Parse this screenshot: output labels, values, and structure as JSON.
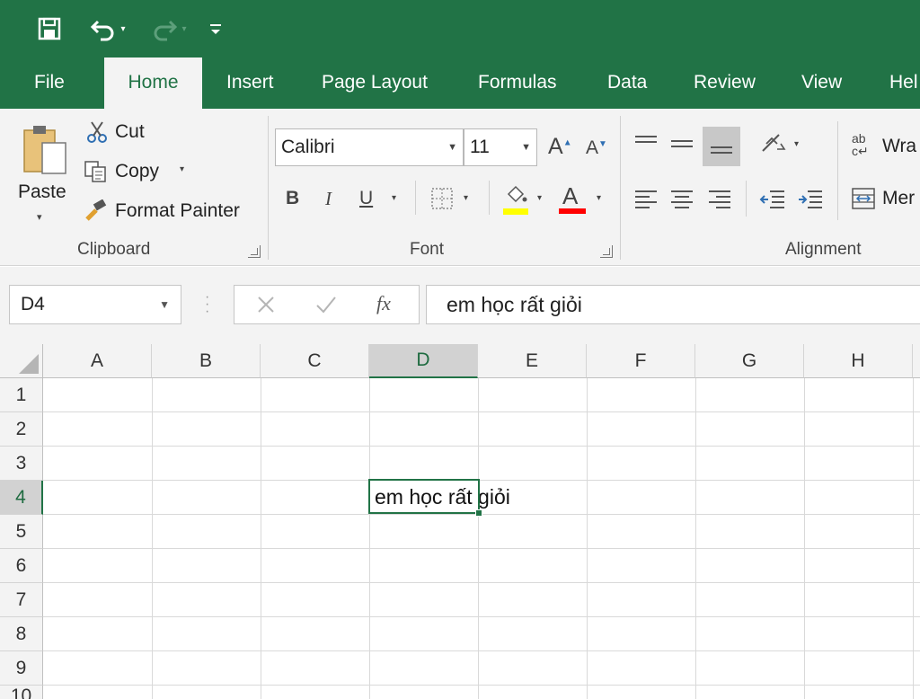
{
  "quick_access": {
    "save_icon": "save-icon",
    "undo_icon": "undo-icon",
    "redo_icon": "redo-icon",
    "customize_icon": "customize-qat-icon"
  },
  "tabs": [
    {
      "label": "File"
    },
    {
      "label": "Home"
    },
    {
      "label": "Insert"
    },
    {
      "label": "Page Layout"
    },
    {
      "label": "Formulas"
    },
    {
      "label": "Data"
    },
    {
      "label": "Review"
    },
    {
      "label": "View"
    },
    {
      "label": "Hel"
    }
  ],
  "clipboard": {
    "paste": "Paste",
    "cut": "Cut",
    "copy": "Copy",
    "format_painter": "Format Painter",
    "group": "Clipboard"
  },
  "font": {
    "family": "Calibri",
    "size": "11",
    "bold": "B",
    "italic": "I",
    "underline": "U",
    "font_color_letter": "A",
    "grow": "A",
    "shrink": "A",
    "group": "Font",
    "highlight_color": "#ffff00",
    "font_color": "#ff0000"
  },
  "alignment": {
    "wrap": "Wra",
    "merge": "Mer",
    "group": "Alignment"
  },
  "formula_bar": {
    "name_box": "D4",
    "fx": "fx",
    "content": "em học rất giỏi"
  },
  "grid": {
    "columns": [
      "A",
      "B",
      "C",
      "D",
      "E",
      "F",
      "G",
      "H"
    ],
    "rows": [
      "1",
      "2",
      "3",
      "4",
      "5",
      "6",
      "7",
      "8",
      "9",
      "10"
    ],
    "selected_column": "D",
    "selected_row": "4",
    "cell_d4": "em học rất giỏi"
  },
  "colors": {
    "accent": "#217346"
  }
}
